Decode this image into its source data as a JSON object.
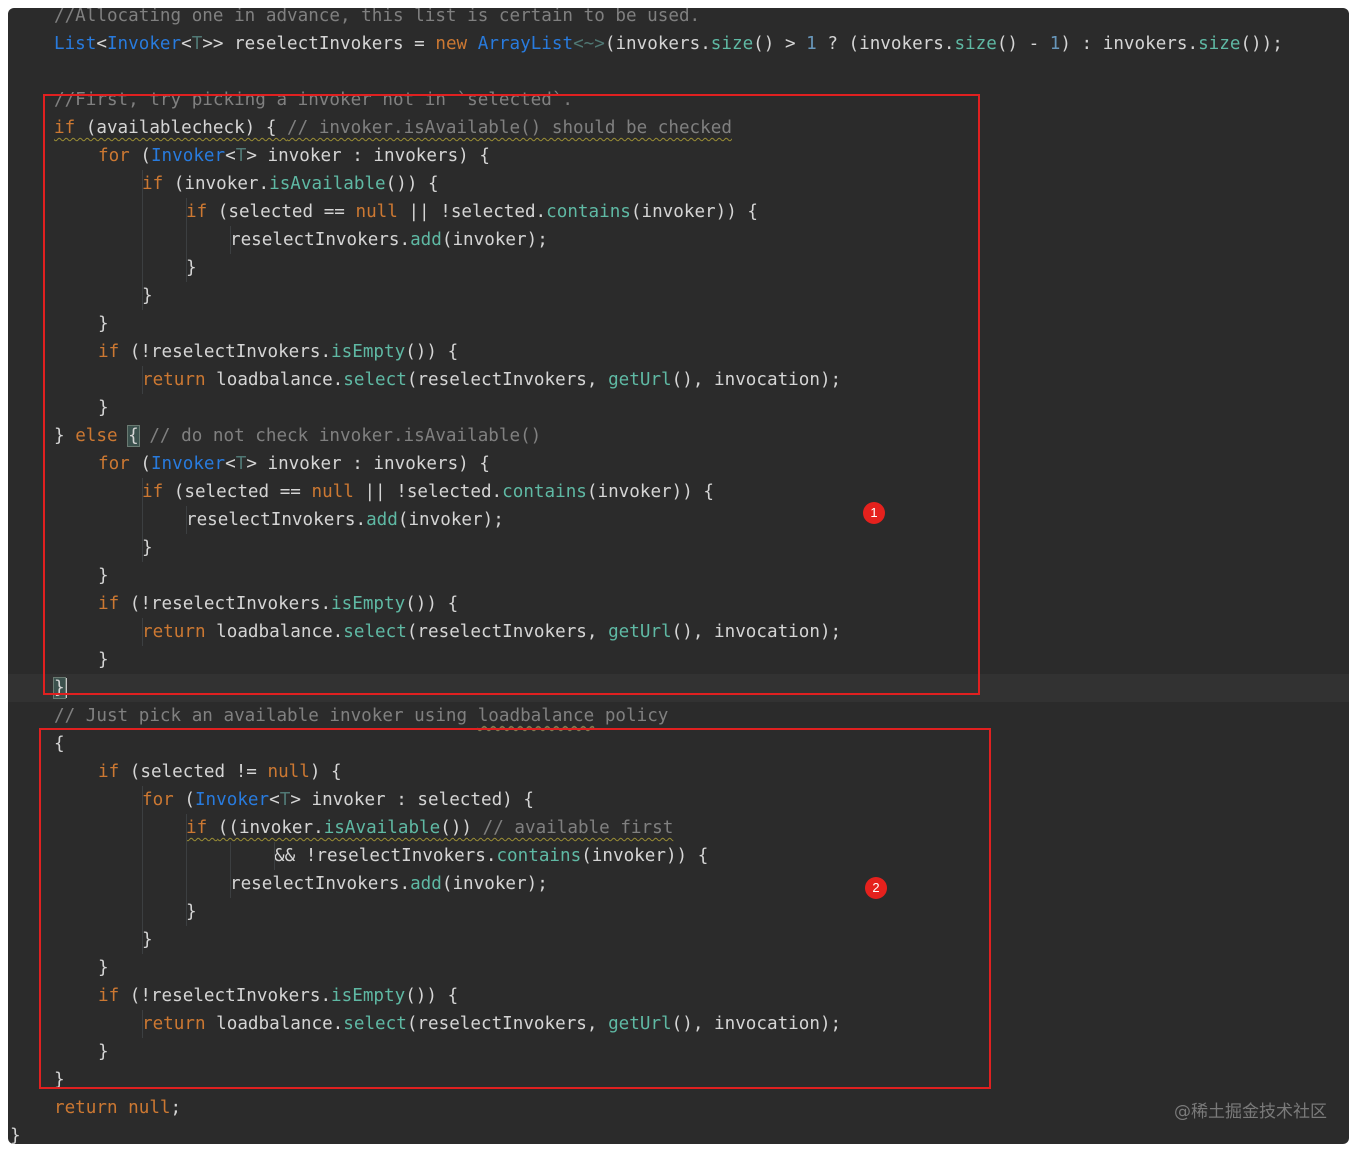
{
  "code_lines": [
    {
      "indent": 1,
      "tokens": [
        {
          "t": "//Allocating one in advance, this list is certain to be used.",
          "c": "t-cmt"
        }
      ]
    },
    {
      "indent": 1,
      "tokens": [
        {
          "t": "List",
          "c": "t-type"
        },
        {
          "t": "<",
          "c": "t-plain"
        },
        {
          "t": "Invoker",
          "c": "t-type"
        },
        {
          "t": "<",
          "c": "t-plain"
        },
        {
          "t": "T",
          "c": "t-gen"
        },
        {
          "t": ">> reselectInvokers = ",
          "c": "t-plain"
        },
        {
          "t": "new ",
          "c": "t-kw"
        },
        {
          "t": "ArrayList",
          "c": "t-type"
        },
        {
          "t": "<~>",
          "c": "t-gen"
        },
        {
          "t": "(invokers.",
          "c": "t-plain"
        },
        {
          "t": "size",
          "c": "t-m"
        },
        {
          "t": "() > ",
          "c": "t-plain"
        },
        {
          "t": "1",
          "c": "t-num"
        },
        {
          "t": " ? (invokers.",
          "c": "t-plain"
        },
        {
          "t": "size",
          "c": "t-m"
        },
        {
          "t": "() - ",
          "c": "t-plain"
        },
        {
          "t": "1",
          "c": "t-num"
        },
        {
          "t": ") : invokers.",
          "c": "t-plain"
        },
        {
          "t": "size",
          "c": "t-m"
        },
        {
          "t": "());",
          "c": "t-plain"
        }
      ]
    },
    {
      "indent": 0,
      "tokens": []
    },
    {
      "indent": 1,
      "tokens": [
        {
          "t": "//First, try picking a invoker not in `selected`.",
          "c": "t-cmt"
        }
      ]
    },
    {
      "indent": 1,
      "tokens": [
        {
          "t": "if",
          "c": "t-kw squig"
        },
        {
          "t": " (availablecheck) { ",
          "c": "t-plain squig"
        },
        {
          "t": "// invoker.isAvailable() should be checked",
          "c": "t-cmt squig"
        }
      ]
    },
    {
      "indent": 2,
      "tokens": [
        {
          "t": "for ",
          "c": "t-kw"
        },
        {
          "t": "(",
          "c": "t-plain"
        },
        {
          "t": "Invoker",
          "c": "t-type"
        },
        {
          "t": "<",
          "c": "t-plain"
        },
        {
          "t": "T",
          "c": "t-gen"
        },
        {
          "t": "> invoker : invokers) {",
          "c": "t-plain"
        }
      ]
    },
    {
      "indent": 3,
      "tokens": [
        {
          "t": "if ",
          "c": "t-kw"
        },
        {
          "t": "(invoker.",
          "c": "t-plain"
        },
        {
          "t": "isAvailable",
          "c": "t-m"
        },
        {
          "t": "()) {",
          "c": "t-plain"
        }
      ]
    },
    {
      "indent": 4,
      "tokens": [
        {
          "t": "if ",
          "c": "t-kw"
        },
        {
          "t": "(selected == ",
          "c": "t-plain"
        },
        {
          "t": "null",
          "c": "t-kw"
        },
        {
          "t": " || !selected.",
          "c": "t-plain"
        },
        {
          "t": "contains",
          "c": "t-m"
        },
        {
          "t": "(invoker)) {",
          "c": "t-plain"
        }
      ]
    },
    {
      "indent": 5,
      "tokens": [
        {
          "t": "reselectInvokers.",
          "c": "t-plain"
        },
        {
          "t": "add",
          "c": "t-m"
        },
        {
          "t": "(invoker);",
          "c": "t-plain"
        }
      ]
    },
    {
      "indent": 4,
      "tokens": [
        {
          "t": "}",
          "c": "t-plain"
        }
      ]
    },
    {
      "indent": 3,
      "tokens": [
        {
          "t": "}",
          "c": "t-plain"
        }
      ]
    },
    {
      "indent": 2,
      "tokens": [
        {
          "t": "}",
          "c": "t-plain"
        }
      ]
    },
    {
      "indent": 2,
      "tokens": [
        {
          "t": "if ",
          "c": "t-kw"
        },
        {
          "t": "(!reselectInvokers.",
          "c": "t-plain"
        },
        {
          "t": "isEmpty",
          "c": "t-m"
        },
        {
          "t": "()) {",
          "c": "t-plain"
        }
      ]
    },
    {
      "indent": 3,
      "tokens": [
        {
          "t": "return ",
          "c": "t-kw"
        },
        {
          "t": "loadbalance.",
          "c": "t-plain"
        },
        {
          "t": "select",
          "c": "t-m"
        },
        {
          "t": "(reselectInvokers, ",
          "c": "t-plain"
        },
        {
          "t": "getUrl",
          "c": "t-m"
        },
        {
          "t": "(), invocation);",
          "c": "t-plain"
        }
      ]
    },
    {
      "indent": 2,
      "tokens": [
        {
          "t": "}",
          "c": "t-plain"
        }
      ]
    },
    {
      "indent": 1,
      "tokens": [
        {
          "t": "} ",
          "c": "t-plain"
        },
        {
          "t": "else ",
          "c": "t-kw"
        },
        {
          "t": "{",
          "c": "t-plain bracket"
        },
        {
          "t": " // do not check invoker.isAvailable()",
          "c": "t-cmt"
        }
      ]
    },
    {
      "indent": 2,
      "tokens": [
        {
          "t": "for ",
          "c": "t-kw"
        },
        {
          "t": "(",
          "c": "t-plain"
        },
        {
          "t": "Invoker",
          "c": "t-type"
        },
        {
          "t": "<",
          "c": "t-plain"
        },
        {
          "t": "T",
          "c": "t-gen"
        },
        {
          "t": "> invoker : invokers) {",
          "c": "t-plain"
        }
      ]
    },
    {
      "indent": 3,
      "tokens": [
        {
          "t": "if ",
          "c": "t-kw"
        },
        {
          "t": "(selected == ",
          "c": "t-plain"
        },
        {
          "t": "null",
          "c": "t-kw"
        },
        {
          "t": " || !selected.",
          "c": "t-plain"
        },
        {
          "t": "contains",
          "c": "t-m"
        },
        {
          "t": "(invoker)) {",
          "c": "t-plain"
        }
      ]
    },
    {
      "indent": 4,
      "tokens": [
        {
          "t": "reselectInvokers.",
          "c": "t-plain"
        },
        {
          "t": "add",
          "c": "t-m"
        },
        {
          "t": "(invoker);",
          "c": "t-plain"
        }
      ]
    },
    {
      "indent": 3,
      "tokens": [
        {
          "t": "}",
          "c": "t-plain"
        }
      ]
    },
    {
      "indent": 2,
      "tokens": [
        {
          "t": "}",
          "c": "t-plain"
        }
      ]
    },
    {
      "indent": 2,
      "tokens": [
        {
          "t": "if ",
          "c": "t-kw"
        },
        {
          "t": "(!reselectInvokers.",
          "c": "t-plain"
        },
        {
          "t": "isEmpty",
          "c": "t-m"
        },
        {
          "t": "()) {",
          "c": "t-plain"
        }
      ]
    },
    {
      "indent": 3,
      "tokens": [
        {
          "t": "return ",
          "c": "t-kw"
        },
        {
          "t": "loadbalance.",
          "c": "t-plain"
        },
        {
          "t": "select",
          "c": "t-m"
        },
        {
          "t": "(reselectInvokers, ",
          "c": "t-plain"
        },
        {
          "t": "getUrl",
          "c": "t-m"
        },
        {
          "t": "(), invocation);",
          "c": "t-plain"
        }
      ]
    },
    {
      "indent": 2,
      "tokens": [
        {
          "t": "}",
          "c": "t-plain"
        }
      ]
    },
    {
      "indent": 1,
      "caret": true,
      "tokens": [
        {
          "t": "}",
          "c": "t-plain bracket"
        }
      ]
    },
    {
      "indent": 1,
      "tokens": [
        {
          "t": "// Just pick an available invoker using ",
          "c": "t-cmt"
        },
        {
          "t": "loadbalance",
          "c": "t-cmt w-under"
        },
        {
          "t": " policy",
          "c": "t-cmt"
        }
      ]
    },
    {
      "indent": 1,
      "tokens": [
        {
          "t": "{",
          "c": "t-plain"
        }
      ]
    },
    {
      "indent": 2,
      "tokens": [
        {
          "t": "if ",
          "c": "t-kw"
        },
        {
          "t": "(selected != ",
          "c": "t-plain"
        },
        {
          "t": "null",
          "c": "t-kw"
        },
        {
          "t": ") {",
          "c": "t-plain"
        }
      ]
    },
    {
      "indent": 3,
      "tokens": [
        {
          "t": "for ",
          "c": "t-kw"
        },
        {
          "t": "(",
          "c": "t-plain"
        },
        {
          "t": "Invoker",
          "c": "t-type"
        },
        {
          "t": "<",
          "c": "t-plain"
        },
        {
          "t": "T",
          "c": "t-gen"
        },
        {
          "t": "> invoker : selected) {",
          "c": "t-plain"
        }
      ]
    },
    {
      "indent": 4,
      "tokens": [
        {
          "t": "if ",
          "c": "t-kw squig"
        },
        {
          "t": "((invoker.",
          "c": "t-plain squig"
        },
        {
          "t": "isAvailable",
          "c": "t-m squig"
        },
        {
          "t": "()) ",
          "c": "t-plain squig"
        },
        {
          "t": "// available first",
          "c": "t-cmt squig"
        }
      ]
    },
    {
      "indent": 6,
      "tokens": [
        {
          "t": "&& !reselectInvokers.",
          "c": "t-plain"
        },
        {
          "t": "contains",
          "c": "t-m"
        },
        {
          "t": "(invoker)) {",
          "c": "t-plain"
        }
      ]
    },
    {
      "indent": 5,
      "tokens": [
        {
          "t": "reselectInvokers.",
          "c": "t-plain"
        },
        {
          "t": "add",
          "c": "t-m"
        },
        {
          "t": "(invoker);",
          "c": "t-plain"
        }
      ]
    },
    {
      "indent": 4,
      "tokens": [
        {
          "t": "}",
          "c": "t-plain"
        }
      ]
    },
    {
      "indent": 3,
      "tokens": [
        {
          "t": "}",
          "c": "t-plain"
        }
      ]
    },
    {
      "indent": 2,
      "tokens": [
        {
          "t": "}",
          "c": "t-plain"
        }
      ]
    },
    {
      "indent": 2,
      "tokens": [
        {
          "t": "if ",
          "c": "t-kw"
        },
        {
          "t": "(!reselectInvokers.",
          "c": "t-plain"
        },
        {
          "t": "isEmpty",
          "c": "t-m"
        },
        {
          "t": "()) {",
          "c": "t-plain"
        }
      ]
    },
    {
      "indent": 3,
      "tokens": [
        {
          "t": "return ",
          "c": "t-kw"
        },
        {
          "t": "loadbalance.",
          "c": "t-plain"
        },
        {
          "t": "select",
          "c": "t-m"
        },
        {
          "t": "(reselectInvokers, ",
          "c": "t-plain"
        },
        {
          "t": "getUrl",
          "c": "t-m"
        },
        {
          "t": "(), invocation);",
          "c": "t-plain"
        }
      ]
    },
    {
      "indent": 2,
      "tokens": [
        {
          "t": "}",
          "c": "t-plain"
        }
      ]
    },
    {
      "indent": 1,
      "tokens": [
        {
          "t": "}",
          "c": "t-plain"
        }
      ]
    },
    {
      "indent": 1,
      "tokens": [
        {
          "t": "return ",
          "c": "t-kw"
        },
        {
          "t": "null",
          "c": "t-kw"
        },
        {
          "t": ";",
          "c": "t-plain"
        }
      ]
    },
    {
      "indent": 0,
      "tokens": [
        {
          "t": "}",
          "c": "t-plain"
        }
      ]
    }
  ],
  "annotations": {
    "badge_1": "1",
    "badge_2": "2",
    "box_color": "#e02020"
  },
  "watermark": "@稀土掘金技术社区"
}
